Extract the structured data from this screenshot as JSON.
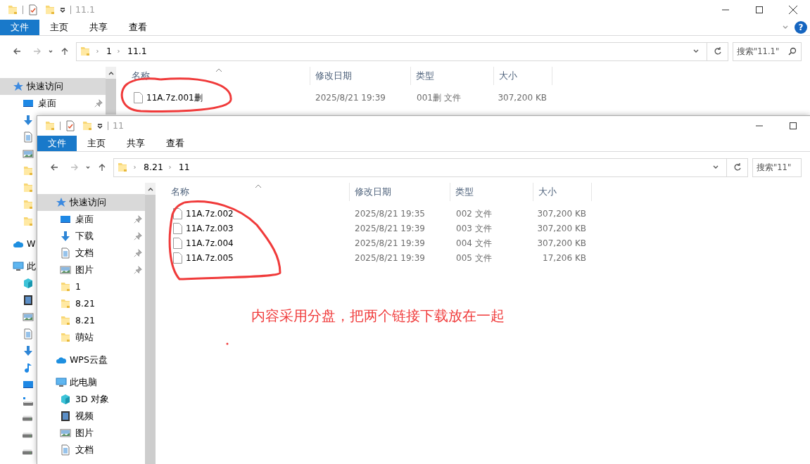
{
  "back_window": {
    "title": "11.1",
    "ribbon_tabs": [
      {
        "label": "文件",
        "selected": true
      },
      {
        "label": "主页",
        "selected": false
      },
      {
        "label": "共享",
        "selected": false
      },
      {
        "label": "查看",
        "selected": false
      }
    ],
    "ribbon_toggle": true,
    "help": "?",
    "path": [
      "1",
      "11.1"
    ],
    "search": {
      "placeholder": "搜索\"11.1\""
    },
    "nav": [
      {
        "kind": "star",
        "label": "快速访问",
        "selected": true,
        "children": [
          {
            "kind": "desktop",
            "label": "桌面",
            "pinned": true
          },
          {
            "kind": "download"
          },
          {
            "kind": "document"
          },
          {
            "kind": "picture"
          },
          {
            "kind": "folder"
          },
          {
            "kind": "folder"
          },
          {
            "kind": "folder"
          },
          {
            "kind": "folder"
          }
        ]
      },
      {
        "kind": "cloud",
        "label": "W",
        "selected": false
      },
      {
        "kind": "pc",
        "label": "此",
        "selected": false,
        "children": [
          {
            "kind": "cube"
          },
          {
            "kind": "film"
          },
          {
            "kind": "picture"
          },
          {
            "kind": "document"
          },
          {
            "kind": "download"
          },
          {
            "kind": "music"
          },
          {
            "kind": "desktop"
          },
          {
            "kind": "network_drive"
          },
          {
            "kind": "drive"
          },
          {
            "kind": "drive"
          },
          {
            "kind": "drive"
          }
        ]
      }
    ],
    "columns": [
      "名称",
      "修改日期",
      "类型",
      "大小"
    ],
    "rows": [
      {
        "name": "11A.7z.001删",
        "date": "2025/8/21 19:39",
        "type": "001删 文件",
        "size": "307,200 KB"
      }
    ]
  },
  "front_window": {
    "title": "11",
    "ribbon_tabs": [
      {
        "label": "文件",
        "selected": true
      },
      {
        "label": "主页",
        "selected": false
      },
      {
        "label": "共享",
        "selected": false
      },
      {
        "label": "查看",
        "selected": false
      }
    ],
    "path": [
      "8.21",
      "11"
    ],
    "search": {
      "placeholder": "搜索\"11\""
    },
    "nav": [
      {
        "kind": "star",
        "label": "快速访问",
        "selected": true,
        "children": [
          {
            "kind": "desktop",
            "label": "桌面",
            "pinned": true
          },
          {
            "kind": "download",
            "label": "下载",
            "pinned": true
          },
          {
            "kind": "document",
            "label": "文档",
            "pinned": true
          },
          {
            "kind": "picture",
            "label": "图片",
            "pinned": true
          },
          {
            "kind": "folder",
            "label": "1",
            "pinned": false
          },
          {
            "kind": "folder",
            "label": "8.21",
            "pinned": false
          },
          {
            "kind": "folder",
            "label": "8.21",
            "pinned": false
          },
          {
            "kind": "folder",
            "label": "萌站",
            "pinned": false
          }
        ]
      },
      {
        "kind": "cloud",
        "label": "WPS云盘",
        "selected": false
      },
      {
        "kind": "pc",
        "label": "此电脑",
        "selected": false,
        "children": [
          {
            "kind": "cube",
            "label": "3D 对象"
          },
          {
            "kind": "film",
            "label": "视频"
          },
          {
            "kind": "picture",
            "label": "图片"
          },
          {
            "kind": "document",
            "label": "文档"
          }
        ]
      }
    ],
    "columns": [
      "名称",
      "修改日期",
      "类型",
      "大小"
    ],
    "rows": [
      {
        "name": "11A.7z.002",
        "date": "2025/8/21 19:35",
        "type": "002 文件",
        "size": "307,200 KB"
      },
      {
        "name": "11A.7z.003",
        "date": "2025/8/21 19:39",
        "type": "003 文件",
        "size": "307,200 KB"
      },
      {
        "name": "11A.7z.004",
        "date": "2025/8/21 19:39",
        "type": "004 文件",
        "size": "307,200 KB"
      },
      {
        "name": "11A.7z.005",
        "date": "2025/8/21 19:39",
        "type": "005 文件",
        "size": "17,206 KB"
      }
    ]
  },
  "annotation": {
    "note": "内容采用分盘，把两个链接下载放在一起"
  }
}
